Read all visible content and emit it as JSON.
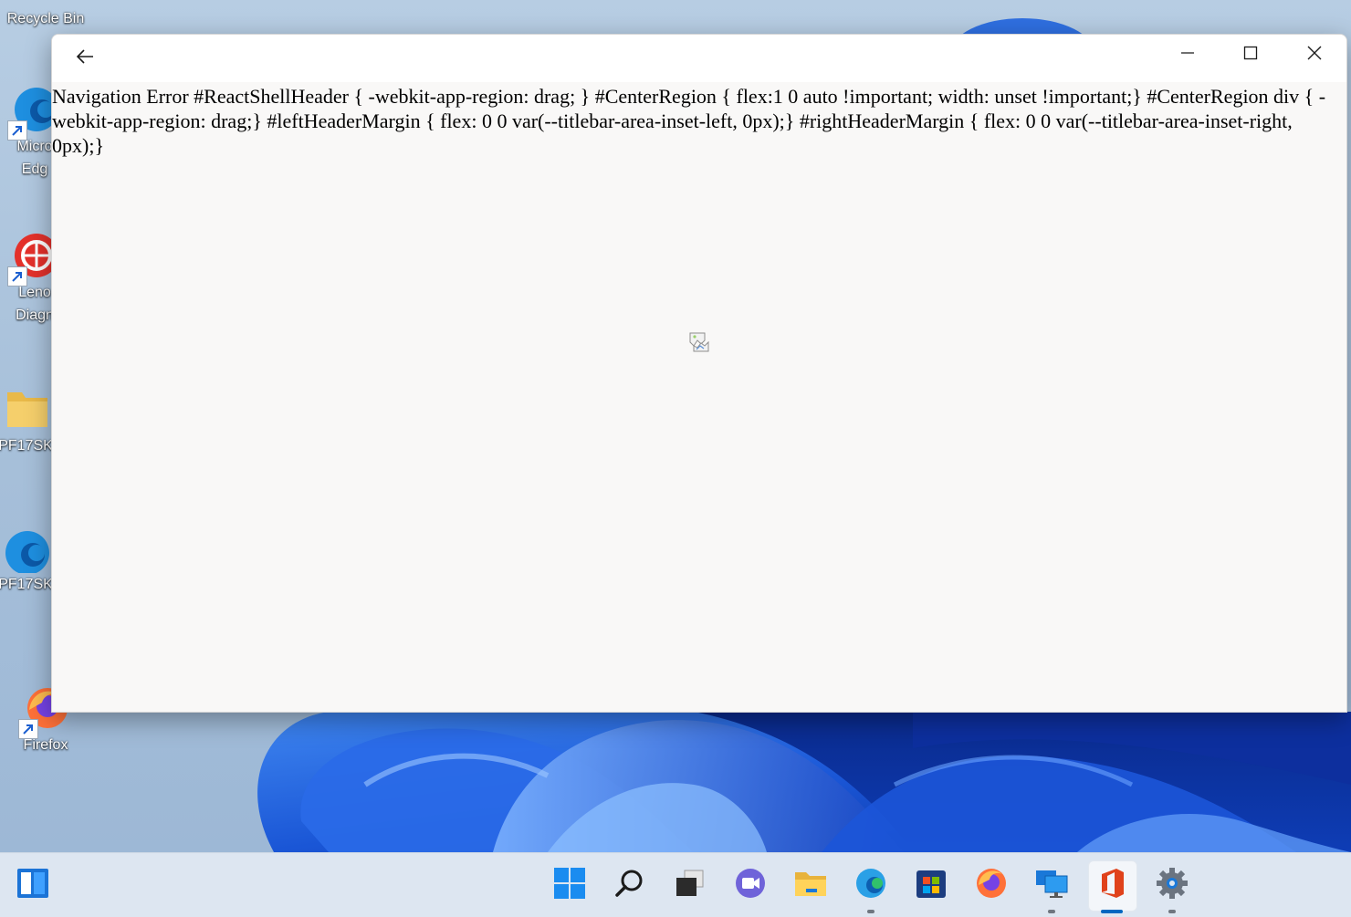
{
  "desktop": {
    "icons": [
      {
        "id": "recycle-bin",
        "label": "Recycle Bin"
      },
      {
        "id": "microsoft-edge",
        "label_line1": "Micro",
        "label_line2": "Edg"
      },
      {
        "id": "lenovo-diagnostics",
        "label_line1": "Leno",
        "label_line2": "Diagn"
      },
      {
        "id": "folder",
        "label": "PF17SK"
      },
      {
        "id": "edge-shortcut",
        "label": "PF17SK"
      },
      {
        "id": "firefox",
        "label": "Firefox"
      }
    ]
  },
  "window": {
    "error_text": "Navigation Error #ReactShellHeader { -webkit-app-region: drag; } #CenterRegion { flex:1 0 auto !important; width: unset !important;} #CenterRegion div { -webkit-app-region: drag;} #leftHeaderMargin { flex: 0 0 var(--titlebar-area-inset-left, 0px);} #rightHeaderMargin { flex: 0 0 var(--titlebar-area-inset-right, 0px);}",
    "buttons": {
      "back": "back-arrow-icon",
      "minimize": "minimize-icon",
      "maximize": "maximize-icon",
      "close": "close-icon"
    }
  },
  "taskbar": {
    "items": [
      {
        "name": "widgets",
        "icon": "widgets-icon"
      },
      {
        "name": "start",
        "icon": "windows-logo-icon"
      },
      {
        "name": "search",
        "icon": "search-icon"
      },
      {
        "name": "task-view",
        "icon": "task-view-icon"
      },
      {
        "name": "chat",
        "icon": "chat-icon"
      },
      {
        "name": "file-explorer",
        "icon": "folder-icon"
      },
      {
        "name": "edge",
        "icon": "edge-icon",
        "running": true
      },
      {
        "name": "store",
        "icon": "store-icon"
      },
      {
        "name": "firefox",
        "icon": "firefox-icon"
      },
      {
        "name": "remote-desktop",
        "icon": "remote-desktop-icon",
        "running": true
      },
      {
        "name": "office",
        "icon": "office-icon",
        "running": true,
        "active": true
      },
      {
        "name": "settings",
        "icon": "settings-icon",
        "running": true
      }
    ]
  },
  "colors": {
    "accent": "#0067c0",
    "window_bg": "#f9f8f7",
    "taskbar_bg": "#dde6f1",
    "wallpaper_blue": "#1d5fd8"
  }
}
